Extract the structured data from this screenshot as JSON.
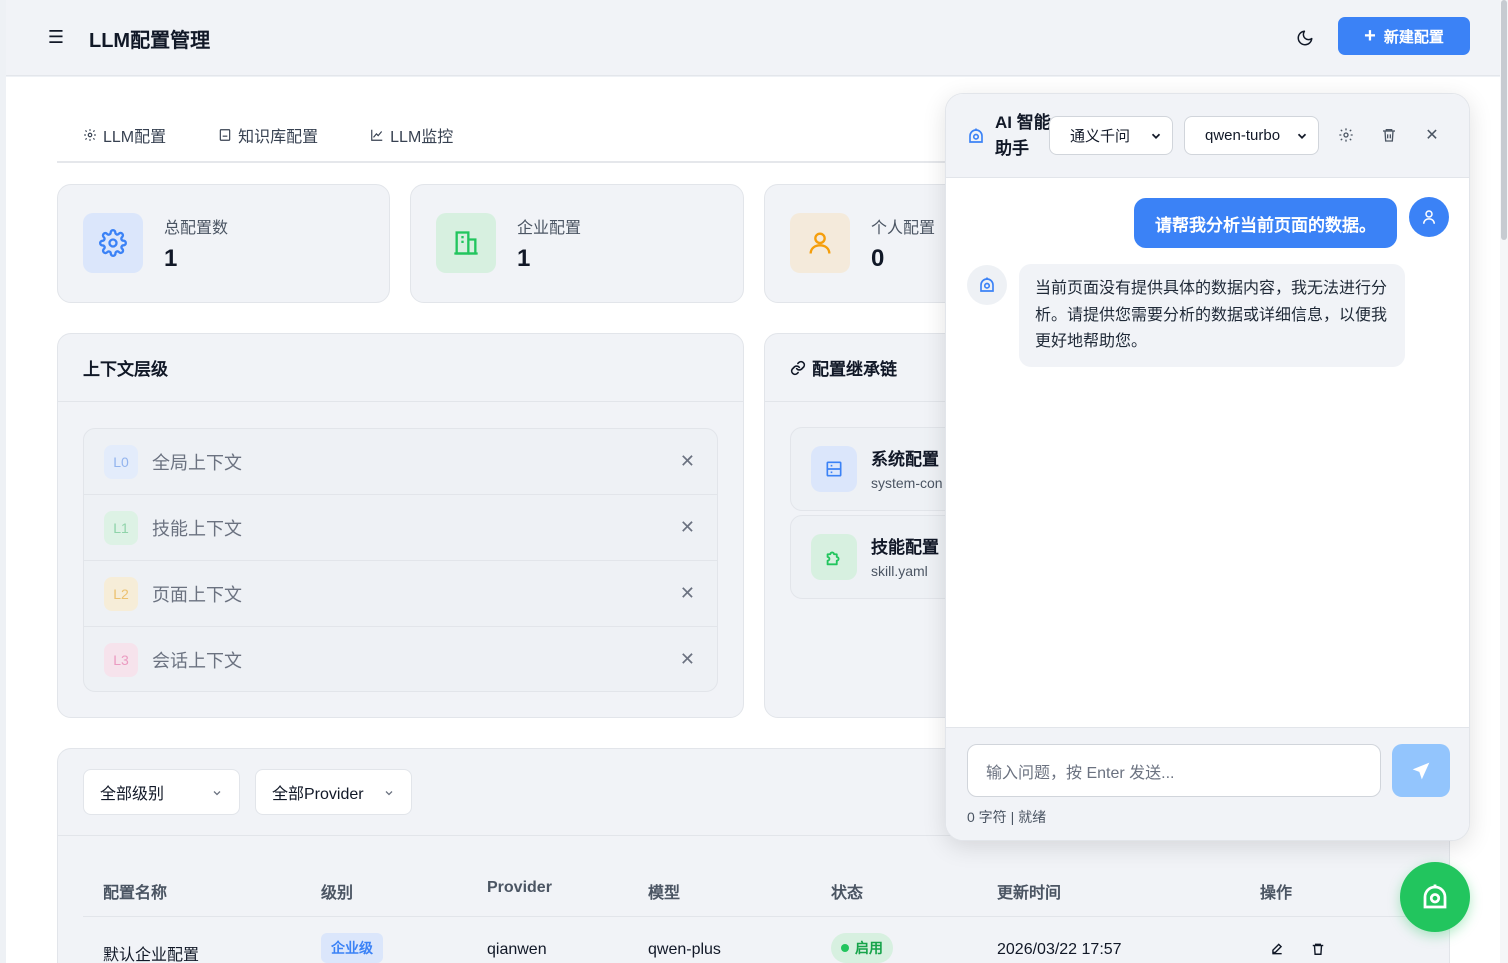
{
  "header": {
    "menu_icon": "hamburger-icon",
    "title": "LLM配置管理",
    "theme_icon": "moon-icon",
    "new_button_icon": "plus-icon",
    "new_button_label": "新建配置"
  },
  "tabs": [
    {
      "label": "LLM配置",
      "icon": "gear-icon"
    },
    {
      "label": "知识库配置",
      "icon": "document-icon"
    },
    {
      "label": "LLM监控",
      "icon": "line-chart-icon"
    }
  ],
  "stats": [
    {
      "label": "总配置数",
      "value": "1",
      "icon": "gear-icon",
      "color": "#3b82f6"
    },
    {
      "label": "企业配置",
      "value": "1",
      "icon": "building-icon",
      "color": "#22c55e"
    },
    {
      "label": "个人配置",
      "value": "0",
      "icon": "user-icon",
      "color": "#f59e0b"
    }
  ],
  "context": {
    "title": "上下文层级",
    "layers": [
      {
        "badge": "L0",
        "name": "全局上下文",
        "color": "#3b82f6"
      },
      {
        "badge": "L1",
        "name": "技能上下文",
        "color": "#22c55e"
      },
      {
        "badge": "L2",
        "name": "页面上下文",
        "color": "#f59e0b"
      },
      {
        "badge": "L3",
        "name": "会话上下文",
        "color": "#ec4899"
      }
    ]
  },
  "chain": {
    "title": "配置继承链",
    "icon": "link-icon",
    "items": [
      {
        "name": "系统配置",
        "file": "system-con",
        "icon": "server-icon"
      },
      {
        "name": "技能配置",
        "file": "skill.yaml",
        "icon": "puzzle-icon"
      }
    ]
  },
  "filters": {
    "level": "全部级别",
    "provider": "全部Provider"
  },
  "table": {
    "headers": [
      "配置名称",
      "级别",
      "Provider",
      "模型",
      "状态",
      "更新时间",
      "操作"
    ],
    "rows": [
      {
        "name": "默认企业配置",
        "level": "企业级",
        "provider": "qianwen",
        "model": "qwen-plus",
        "status": "启用",
        "updated": "2026/03/22 17:57"
      }
    ]
  },
  "chat": {
    "title": "AI 智能助手",
    "provider": "通义千问",
    "model": "qwen-turbo",
    "user_message": "请帮我分析当前页面的数据。",
    "bot_message": "当前页面没有提供具体的数据内容，我无法进行分析。请提供您需要分析的数据或详细信息，以便我更好地帮助您。",
    "input_placeholder": "输入问题，按 Enter 发送...",
    "status": "0 字符 | 就绪"
  },
  "colors": {
    "accent": "#3b82f6",
    "success": "#22c55e",
    "warning": "#f59e0b"
  }
}
